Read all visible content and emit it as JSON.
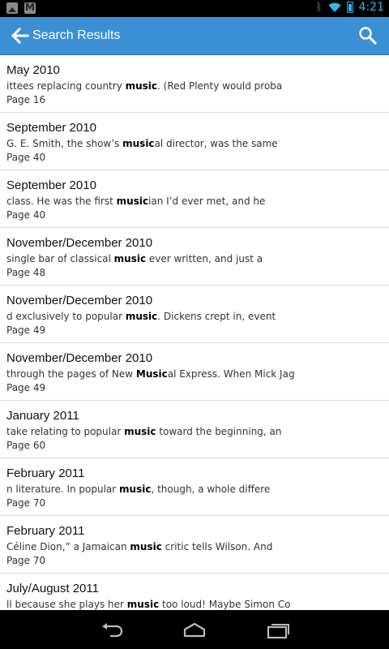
{
  "status_bar": {
    "time": "4:21",
    "icons": [
      "gallery-icon",
      "gmail-icon",
      "bluetooth-icon",
      "wifi-icon",
      "battery-icon"
    ]
  },
  "action_bar": {
    "title": "Search Results",
    "color": "#3b8fd5",
    "icons": [
      "back-arrow-icon",
      "search-icon"
    ]
  },
  "results": [
    {
      "date": "May 2010",
      "before": "ittees replacing country ",
      "match": "music",
      "after": ". (Red Plenty would proba",
      "page": "Page 16"
    },
    {
      "date": "September 2010",
      "before": "G. E. Smith, the show’s ",
      "match": "music",
      "after": "al director, was the same",
      "page": "Page 40"
    },
    {
      "date": "September 2010",
      "before": "class. He was the first ",
      "match": "music",
      "after": "ian I’d ever met, and he",
      "page": "Page 40"
    },
    {
      "date": "November/December 2010",
      "before": "single bar of classical ",
      "match": "music",
      "after": " ever written, and just a",
      "page": "Page 48"
    },
    {
      "date": "November/December 2010",
      "before": "d exclusively to popular ",
      "match": "music",
      "after": ". Dickens crept in, event",
      "page": "Page 49"
    },
    {
      "date": "November/December 2010",
      "before": "through the pages of New ",
      "match": "Music",
      "after": "al Express. When Mick Jag",
      "page": "Page 49"
    },
    {
      "date": "January 2011",
      "before": "take relating to popular ",
      "match": "music",
      "after": " toward the beginning, an",
      "page": "Page 60"
    },
    {
      "date": "February 2011",
      "before": "n literature. In popular ",
      "match": "music",
      "after": ", though, a whole differe",
      "page": "Page 70"
    },
    {
      "date": "February 2011",
      "before": "Céline Dion,” a Jamaican ",
      "match": "music",
      "after": " critic tells Wilson. And",
      "page": "Page 70"
    },
    {
      "date": "July/August 2011",
      "before": "ll because she plays her ",
      "match": "music",
      "after": " too loud! Maybe Simon Co",
      "page": ""
    }
  ],
  "nav_bar": {
    "icons": [
      "nav-back-icon",
      "nav-home-icon",
      "nav-recent-apps-icon"
    ]
  }
}
